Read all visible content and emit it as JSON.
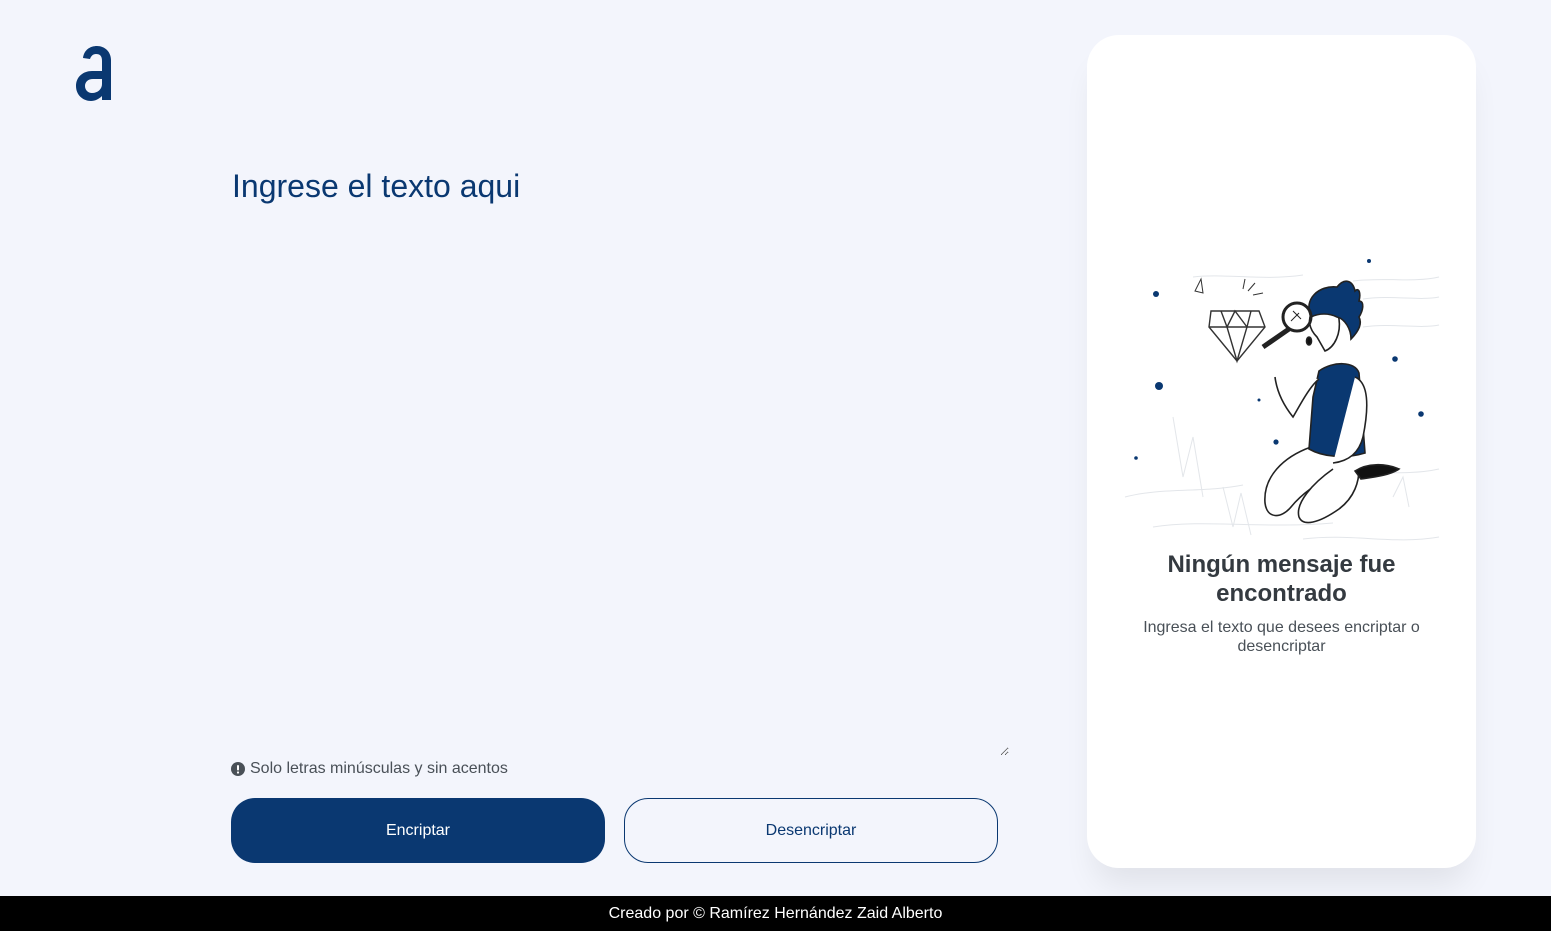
{
  "brand": {
    "logo_icon": "alura-a-logo",
    "color": "#0a3871"
  },
  "input": {
    "placeholder": "Ingrese el texto aqui",
    "value": ""
  },
  "hint": {
    "icon": "exclamation-circle-icon",
    "text": "Solo letras minúsculas y sin acentos"
  },
  "buttons": {
    "encrypt_label": "Encriptar",
    "decrypt_label": "Desencriptar"
  },
  "output": {
    "illustration": "person-with-magnifier-illustration",
    "title": "Ningún mensaje fue encontrado",
    "subtitle": "Ingresa el texto que desees encriptar o desencriptar"
  },
  "footer": {
    "text": "Creado por © Ramírez Hernández Zaid Alberto"
  },
  "colors": {
    "background": "#f3f5fc",
    "primary": "#0a3871",
    "panel": "#ffffff",
    "footer": "#000000"
  }
}
